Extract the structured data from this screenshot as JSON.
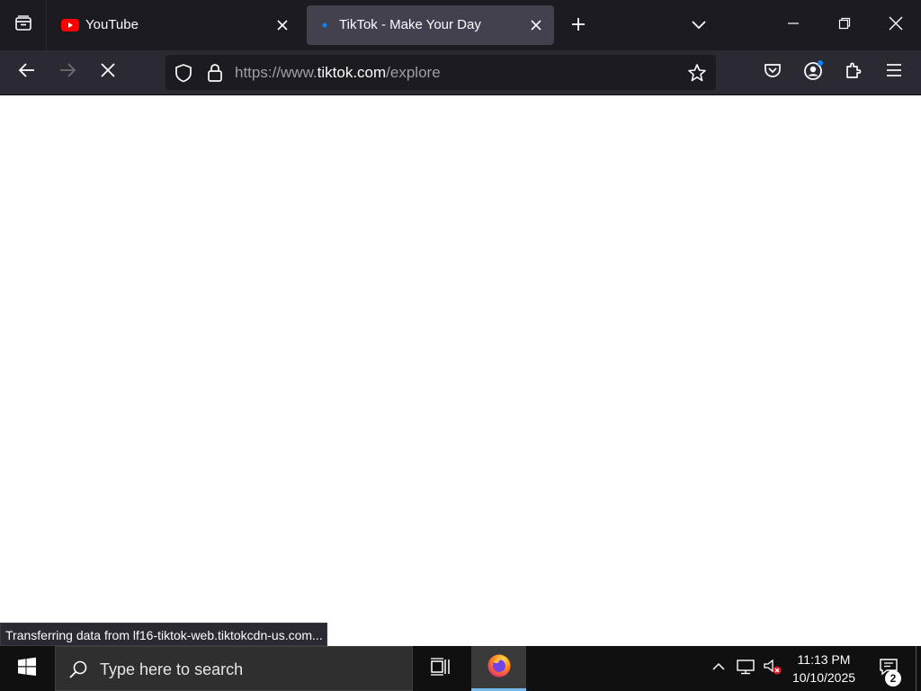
{
  "browser": {
    "tabs": [
      {
        "title": "YouTube",
        "favicon": "youtube-icon",
        "active": false
      },
      {
        "title": "TikTok - Make Your Day",
        "favicon": "loading-dot-icon",
        "active": true
      }
    ],
    "url": {
      "prefix": "https://www.",
      "host": "tiktok.com",
      "path": "/explore"
    },
    "status_text": "Transferring data from lf16-tiktok-web.tiktokcdn-us.com..."
  },
  "taskbar": {
    "search_placeholder": "Type here to search",
    "time": "11:13 PM",
    "date": "10/10/2025",
    "notification_count": "2"
  },
  "colors": {
    "tabstrip_bg": "#1c1b22",
    "toolbar_bg": "#2b2a33",
    "active_tab_bg": "#42414d",
    "taskbar_bg": "#101010",
    "accent_blue": "#0a84ff"
  }
}
